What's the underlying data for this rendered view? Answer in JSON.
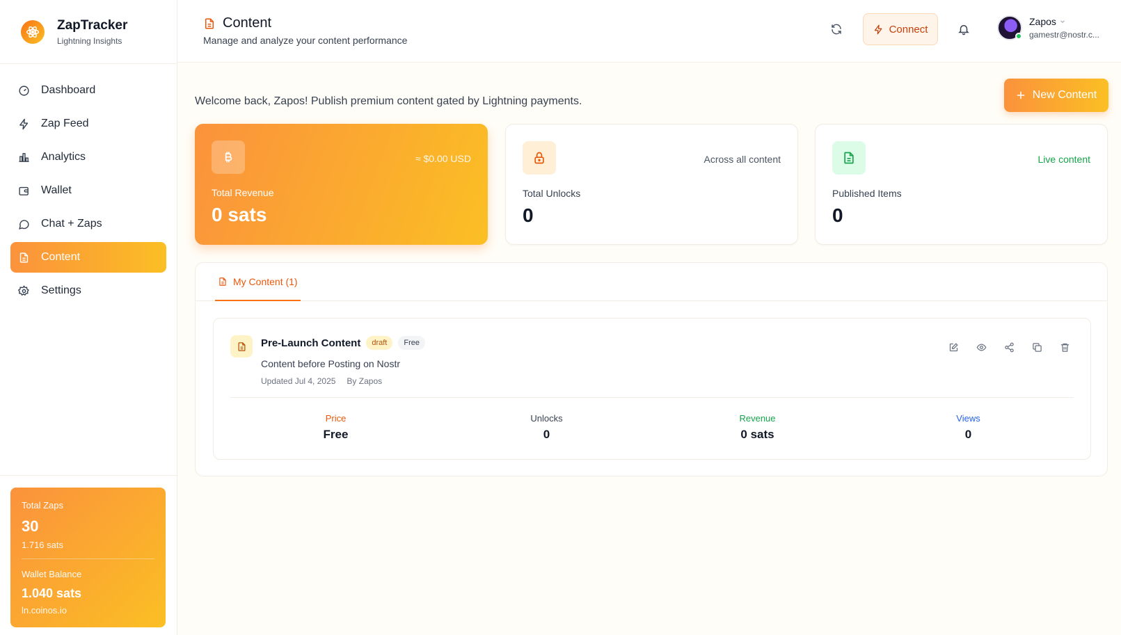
{
  "brand": {
    "title": "ZapTracker",
    "subtitle": "Lightning Insights"
  },
  "sidebar": {
    "items": [
      {
        "label": "Dashboard",
        "icon": "dashboard-icon"
      },
      {
        "label": "Zap Feed",
        "icon": "zap-icon"
      },
      {
        "label": "Analytics",
        "icon": "bar-chart-icon"
      },
      {
        "label": "Wallet",
        "icon": "wallet-icon"
      },
      {
        "label": "Chat + Zaps",
        "icon": "chat-icon"
      },
      {
        "label": "Content",
        "icon": "document-icon",
        "active": true
      },
      {
        "label": "Settings",
        "icon": "gear-icon"
      }
    ],
    "stats": {
      "zaps_label": "Total Zaps",
      "zaps_value": "30",
      "zaps_sats": "1.716 sats",
      "wallet_label": "Wallet Balance",
      "wallet_value": "1.040 sats",
      "wallet_host": "ln.coinos.io"
    }
  },
  "header": {
    "title": "Content",
    "subtitle": "Manage and analyze your content performance",
    "connect_label": "Connect",
    "user_name": "Zapos",
    "user_email": "gamestr@nostr.c..."
  },
  "main": {
    "welcome": "Welcome back, Zapos! Publish premium content gated by Lightning payments.",
    "new_button": "New Content",
    "cards": {
      "revenue": {
        "note": "≈ $0.00 USD",
        "label": "Total Revenue",
        "value": "0 sats"
      },
      "unlocks": {
        "note": "Across all content",
        "label": "Total Unlocks",
        "value": "0"
      },
      "published": {
        "note": "Live content",
        "label": "Published Items",
        "value": "0"
      }
    },
    "tab_label": "My Content (1)",
    "item": {
      "title": "Pre-Launch Content",
      "badge_status": "draft",
      "badge_price": "Free",
      "description": "Content before Posting on Nostr",
      "updated": "Updated Jul 4, 2025",
      "author": "By Zapos",
      "metrics": [
        {
          "label": "Price",
          "value": "Free",
          "color": "#ea580c"
        },
        {
          "label": "Unlocks",
          "value": "0",
          "color": "#374151"
        },
        {
          "label": "Revenue",
          "value": "0 sats",
          "color": "#16a34a"
        },
        {
          "label": "Views",
          "value": "0",
          "color": "#2563eb"
        }
      ]
    }
  },
  "colors": {
    "accent": "#f97316",
    "accent_end": "#fbbf24"
  }
}
